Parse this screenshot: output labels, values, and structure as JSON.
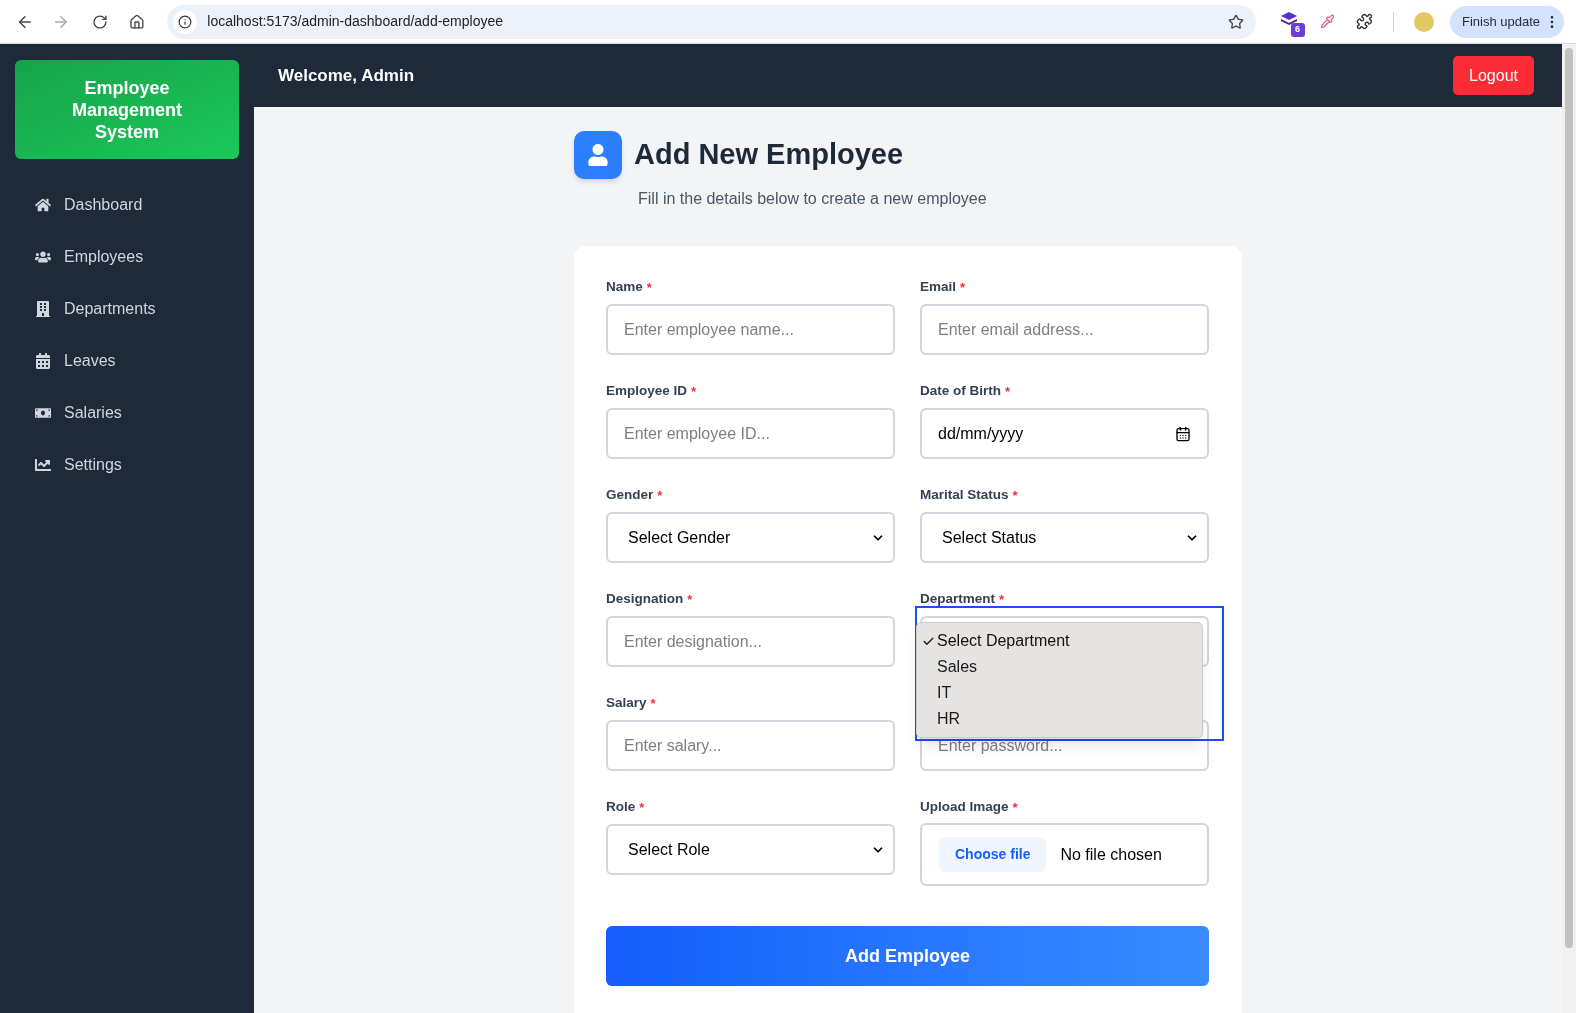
{
  "browser": {
    "url": "localhost:5173/admin-dashboard/add-employee",
    "extension_badge": "6",
    "update_button": "Finish update"
  },
  "sidebar": {
    "brand": "Employee Management System",
    "items": [
      {
        "label": "Dashboard"
      },
      {
        "label": "Employees"
      },
      {
        "label": "Departments"
      },
      {
        "label": "Leaves"
      },
      {
        "label": "Salaries"
      },
      {
        "label": "Settings"
      }
    ]
  },
  "header": {
    "welcome": "Welcome, Admin",
    "logout": "Logout"
  },
  "page": {
    "title": "Add New Employee",
    "subtitle": "Fill in the details below to create a new employee"
  },
  "form": {
    "fields": [
      {
        "kind": "text",
        "label": "Name",
        "mark": "*",
        "placeholder": "Enter employee name..."
      },
      {
        "kind": "text",
        "label": "Email",
        "mark": "*",
        "placeholder": "Enter email address..."
      },
      {
        "kind": "text",
        "label": "Employee ID",
        "mark": "*",
        "placeholder": "Enter employee ID..."
      },
      {
        "kind": "date",
        "label": "Date of Birth",
        "mark": "*",
        "value": "dd/mm/yyyy"
      },
      {
        "kind": "select",
        "label": "Gender",
        "mark": "*",
        "value": "Select Gender"
      },
      {
        "kind": "select",
        "label": "Marital Status",
        "mark": "*",
        "value": "Select Status"
      },
      {
        "kind": "text",
        "label": "Designation",
        "mark": "*",
        "placeholder": "Enter designation..."
      },
      {
        "kind": "dropdown",
        "label": "Department",
        "mark": "*",
        "open": true,
        "options": [
          {
            "label": "Select Department",
            "selected": true
          },
          {
            "label": "Sales",
            "selected": false
          },
          {
            "label": "IT",
            "selected": false
          },
          {
            "label": "HR",
            "selected": false
          }
        ]
      },
      {
        "kind": "text",
        "label": "Salary",
        "mark": "*",
        "placeholder": "Enter salary..."
      },
      {
        "kind": "text",
        "placeholder": "Enter password..."
      },
      {
        "kind": "select",
        "label": "Role",
        "mark": "*",
        "value": "Select Role"
      },
      {
        "kind": "file",
        "label": "Upload Image",
        "mark": "*",
        "button": "Choose file",
        "status": "No file chosen"
      }
    ],
    "submit": "Add Employee"
  }
}
